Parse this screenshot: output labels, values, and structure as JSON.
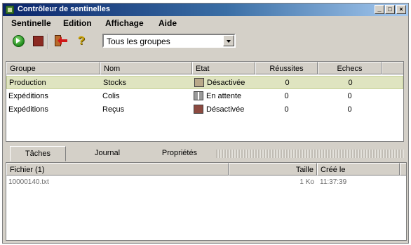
{
  "window": {
    "title": "Contrôleur de sentinelles"
  },
  "titlebar_buttons": {
    "minimize": "_",
    "maximize": "□",
    "close": "×"
  },
  "menu": {
    "items": [
      "Sentinelle",
      "Edition",
      "Affichage",
      "Aide"
    ]
  },
  "toolbar": {
    "icons": [
      "play-icon",
      "stop-icon",
      "exit-door-icon",
      "help-icon"
    ],
    "help_glyph": "?",
    "group_select": {
      "value": "Tous les groupes"
    }
  },
  "grid": {
    "columns": [
      "Groupe",
      "Nom",
      "Etat",
      "Réussites",
      "Echecs"
    ],
    "rows": [
      {
        "groupe": "Production",
        "nom": "Stocks",
        "etat": "Désactivée",
        "reussites": "0",
        "echecs": "0",
        "selected": true,
        "status_color": "#b9a98a"
      },
      {
        "groupe": "Expéditions",
        "nom": "Colis",
        "etat": "En attente",
        "reussites": "0",
        "echecs": "0",
        "selected": false,
        "status_color": "#7a7a7a"
      },
      {
        "groupe": "Expéditions",
        "nom": "Reçus",
        "etat": "Désactivée",
        "reussites": "0",
        "echecs": "0",
        "selected": false,
        "status_color": "#8c4a40"
      }
    ]
  },
  "tabs": {
    "items": [
      "Tâches",
      "Journal",
      "Propriétés"
    ],
    "active": "Tâches"
  },
  "file_list": {
    "columns": [
      "Fichier (1)",
      "Taille",
      "Créé le"
    ],
    "rows": [
      {
        "fichier": "10000140.txt",
        "taille": "1 Ko",
        "cree_le": "11:37:39"
      }
    ]
  }
}
